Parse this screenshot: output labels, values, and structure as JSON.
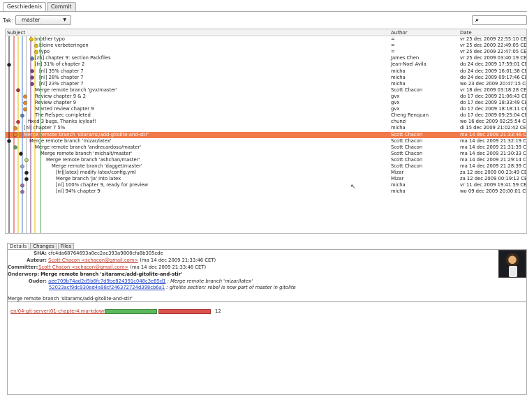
{
  "tabs": [
    {
      "label": "Geschiedenis",
      "active": true
    },
    {
      "label": "Commit",
      "active": false
    }
  ],
  "branchbar": {
    "label": "Tak:",
    "branch": "master",
    "search_icon": "search-icon"
  },
  "columns": {
    "subject": "Subject",
    "author": "Author",
    "date": "Date"
  },
  "commits": [
    {
      "subject": "another typo",
      "author": "=",
      "date": "vr 25 dec 2009 22:55:10 CET"
    },
    {
      "subject": "kleine verbeteringen",
      "author": "=",
      "date": "vr 25 dec 2009 22:49:05 CET"
    },
    {
      "subject": "typo",
      "author": "=",
      "date": "vr 25 dec 2009 22:47:05 CET"
    },
    {
      "subject": "[zh] chapter 9: section Packfiles",
      "author": "James Chen",
      "date": "vr 25 dec 2009 03:40:19 CET"
    },
    {
      "subject": "[fr] 31% of chapter 2",
      "author": "Jean-Noel Avila",
      "date": "do 24 dec 2009 17:59:01 CET"
    },
    {
      "subject": "[nl] 35% chapter 7",
      "author": "micha",
      "date": "do 24 dec 2009 16:01:38 CET"
    },
    {
      "subject": "[nl] 28% chapter 7",
      "author": "micha",
      "date": "do 24 dec 2009 09:17:46 CET"
    },
    {
      "subject": "[nl] 23% chapter 7",
      "author": "micha",
      "date": "wo 23 dec 2009 20:47:15 CET"
    },
    {
      "subject": "Merge remote branch 'gvx/master'",
      "author": "Scott Chacon",
      "date": "vr 18 dec 2009 03:18:28 CET"
    },
    {
      "subject": "Review chapter 9 & 2",
      "author": "gvx",
      "date": "do 17 dec 2009 21:06:43 CET"
    },
    {
      "subject": "Review chapter 9",
      "author": "gvx",
      "date": "do 17 dec 2009 18:33:49 CET"
    },
    {
      "subject": "Started review chapter 9",
      "author": "gvx",
      "date": "do 17 dec 2009 18:18:11 CET"
    },
    {
      "subject": "The Refspec completed",
      "author": "Cheng Renquan",
      "date": "do 17 dec 2009 09:25:04 CET"
    },
    {
      "subject": "fixed 3 bugs. Thanks icyleaf!",
      "author": "chunzi",
      "date": "wo 16 dec 2009 02:25:54 CET"
    },
    {
      "subject": "[nl] chapter 7 5%",
      "author": "micha",
      "date": "di 15 dec 2009 21:02:42 CET"
    },
    {
      "subject": "Merge remote branch 'sitaramc/add-gitolite-and-stir'",
      "author": "Scott Chacon",
      "date": "ma 14 dec 2009 21:33:46 CET"
    },
    {
      "subject": "Merge remote branch 'mizar/latex'",
      "author": "Scott Chacon",
      "date": "ma 14 dec 2009 21:32:19 CET"
    },
    {
      "subject": "Merge remote branch 'andrecardoso/master'",
      "author": "Scott Chacon",
      "date": "ma 14 dec 2009 21:31:39 CET"
    },
    {
      "subject": "Merge remote branch 'michalt/master'",
      "author": "Scott Chacon",
      "date": "ma 14 dec 2009 21:30:33 CET"
    },
    {
      "subject": "Merge remote branch 'ashchan/master'",
      "author": "Scott Chacon",
      "date": "ma 14 dec 2009 21:29:14 CET"
    },
    {
      "subject": "Merge remote branch 'dagget/master'",
      "author": "Scott Chacon",
      "date": "ma 14 dec 2009 21:28:39 CET"
    },
    {
      "subject": "[fr][latex] modify latex/config.yml",
      "author": "Mizar",
      "date": "za 12 dec 2009 00:23:49 CET"
    },
    {
      "subject": "Merge branch 'ja' into latex",
      "author": "Mizar",
      "date": "za 12 dec 2009 00:19:12 CET"
    },
    {
      "subject": "[nl] 100% chapter 9, ready for preview",
      "author": "micha",
      "date": "vr 11 dec 2009 19:41:59 CET"
    },
    {
      "subject": "[nl] 94% chapter 9",
      "author": "micha",
      "date": "wo 09 dec 2009 20:00:01 CET"
    }
  ],
  "selected_index": 15,
  "lower_tabs": [
    {
      "label": "Details",
      "active": true
    },
    {
      "label": "Changes",
      "active": false
    },
    {
      "label": "Files",
      "active": false
    }
  ],
  "details": {
    "sha_label": "SHA:",
    "sha": "cfc4da68764693a0ec2ac393a9808cfa8b305cde",
    "author_label": "Auteur:",
    "author_name": "Scott Chacon <schacon@gmail.com>",
    "author_date": "(ma 14 dec 2009 21:33:46 CET)",
    "committer_label": "Committer:",
    "committer_name": "Scott Chacon <schacon@gmail.com>",
    "committer_date": "(ma 14 dec 2009 21:33:46 CET)",
    "subject_label": "Onderwerp:",
    "subject": "Merge remote branch 'sitaramc/add-gitolite-and-stir'",
    "parents_label": "Ouder:",
    "parent1": "aee709b74ad2d5b6fc7d9be824391c048c3e85d1",
    "parent1_msg": ": Merge remote branch 'mizar/latex'",
    "parent2": "52023acf9dc930ed4a98cf246372724d398cb6a1",
    "parent2_msg": ": gitolite section: rebel is now part of master in gitolite",
    "message": "Merge remote branch 'sitaramc/add-gitolite-and-stir'"
  },
  "file_change": {
    "path": "en/04-git-server/01-chapter4.markdown",
    "count": "12",
    "added_fraction": 0.5,
    "removed_fraction": 0.5
  },
  "colors": {
    "selected": "#f07a4a",
    "added": "#5cb85c",
    "removed": "#d9534f",
    "link": "#c0392b",
    "hash_link": "#1a3cc8"
  }
}
